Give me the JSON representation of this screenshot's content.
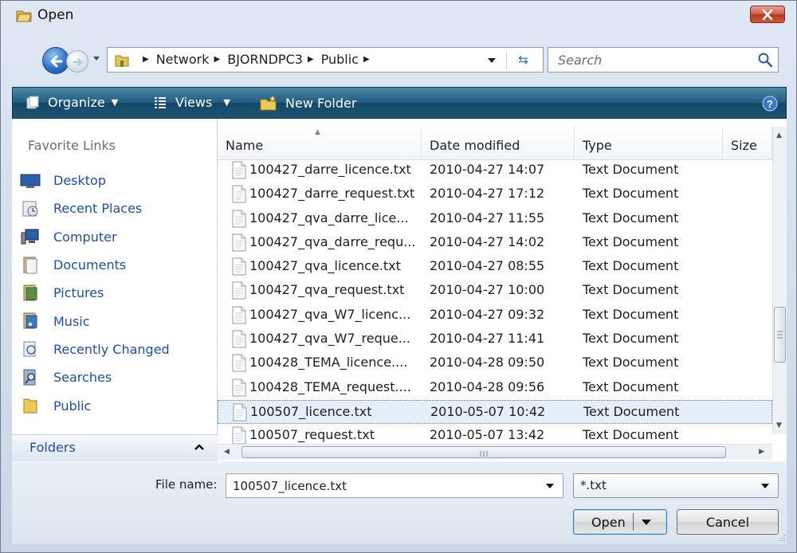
{
  "window": {
    "title": "Open",
    "close_icon": "close-icon"
  },
  "address": {
    "crumbs": [
      "Network",
      "BJORNDPC3",
      "Public"
    ],
    "search_placeholder": "Search"
  },
  "toolbar": {
    "organize_label": "Organize",
    "views_label": "Views",
    "new_folder_label": "New Folder"
  },
  "sidebar": {
    "header": "Favorite Links",
    "items": [
      {
        "label": "Desktop",
        "icon": "desktop-icon"
      },
      {
        "label": "Recent Places",
        "icon": "recent-places-icon"
      },
      {
        "label": "Computer",
        "icon": "computer-icon"
      },
      {
        "label": "Documents",
        "icon": "documents-icon"
      },
      {
        "label": "Pictures",
        "icon": "pictures-icon"
      },
      {
        "label": "Music",
        "icon": "music-icon"
      },
      {
        "label": "Recently Changed",
        "icon": "recently-changed-icon"
      },
      {
        "label": "Searches",
        "icon": "searches-icon"
      },
      {
        "label": "Public",
        "icon": "public-folder-icon"
      }
    ],
    "folders_label": "Folders"
  },
  "columns": {
    "name": "Name",
    "date": "Date modified",
    "type": "Type",
    "size": "Size"
  },
  "files": [
    {
      "name": "100427_darre_licence.txt",
      "date": "2010-04-27 14:07",
      "type": "Text Document"
    },
    {
      "name": "100427_darre_request.txt",
      "date": "2010-04-27 17:12",
      "type": "Text Document"
    },
    {
      "name": "100427_qva_darre_lice...",
      "date": "2010-04-27 11:55",
      "type": "Text Document"
    },
    {
      "name": "100427_qva_darre_requ...",
      "date": "2010-04-27 14:02",
      "type": "Text Document"
    },
    {
      "name": "100427_qva_licence.txt",
      "date": "2010-04-27 08:55",
      "type": "Text Document"
    },
    {
      "name": "100427_qva_request.txt",
      "date": "2010-04-27 10:00",
      "type": "Text Document"
    },
    {
      "name": "100427_qva_W7_licenc...",
      "date": "2010-04-27 09:32",
      "type": "Text Document"
    },
    {
      "name": "100427_qva_W7_reque...",
      "date": "2010-04-27 11:41",
      "type": "Text Document"
    },
    {
      "name": "100428_TEMA_licence....",
      "date": "2010-04-28 09:50",
      "type": "Text Document"
    },
    {
      "name": "100428_TEMA_request....",
      "date": "2010-04-28 09:56",
      "type": "Text Document"
    },
    {
      "name": "100507_licence.txt",
      "date": "2010-05-07 10:42",
      "type": "Text Document",
      "selected": true
    },
    {
      "name": "100507_request.txt",
      "date": "2010-05-07 13:42",
      "type": "Text Document"
    }
  ],
  "footer": {
    "filename_label": "File name:",
    "filename_value": "100507_licence.txt",
    "filetype_value": "*.txt",
    "open_label": "Open",
    "cancel_label": "Cancel"
  }
}
